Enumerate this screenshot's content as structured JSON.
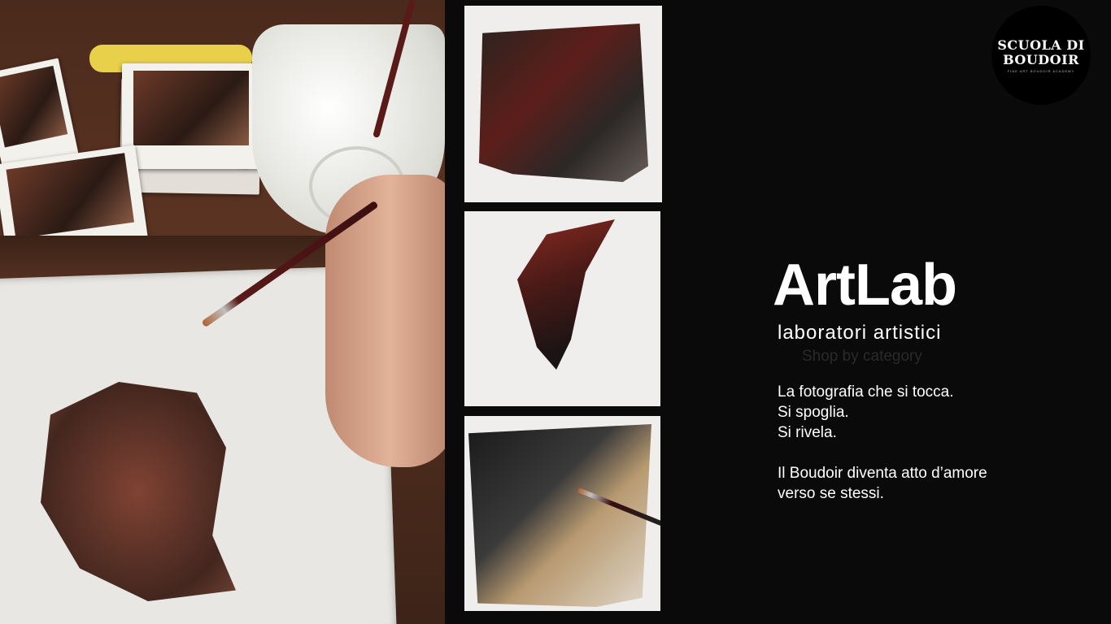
{
  "logo": {
    "line1": "SCUOLA DI",
    "line2": "BOUDOIR",
    "tagline": "FINE ART BOUDOIR ACADEMY"
  },
  "hero": {
    "title": "ArtLab",
    "subtitle": "laboratori artistici",
    "ghost_link": "Shop by category"
  },
  "body": {
    "line1": "La fotografia che si tocca.",
    "line2": "Si spoglia.",
    "line3": "Si rivela.",
    "line4": "Il Boudoir diventa atto d’amore",
    "line5": "verso se stessi."
  },
  "colors": {
    "background": "#0a0a0a",
    "text": "#ffffff",
    "ghost_text": "#2a2a2a"
  }
}
